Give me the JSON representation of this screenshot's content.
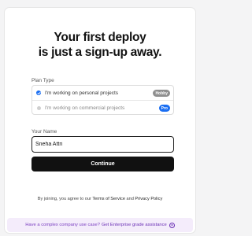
{
  "heading": {
    "line1": "Your first deploy",
    "line2": "is just a sign-up away."
  },
  "plan": {
    "label": "Plan Type",
    "options": [
      {
        "text": "I'm working on personal projects",
        "badge": "Hobby",
        "selected": true
      },
      {
        "text": "I'm working on commercial projects",
        "badge": "Pro",
        "selected": false
      }
    ]
  },
  "name": {
    "label": "Your Name",
    "value": "Sneha Attri"
  },
  "continue_label": "Continue",
  "terms": {
    "prefix": "By joining, you agree to our ",
    "tos": "Terms of Service",
    "and": " and ",
    "privacy": "Privacy Policy"
  },
  "footer": {
    "question": "Have a complex company use case?",
    "link": "Get Enterprise grade assistance",
    "icon": "arrow-right-circle-icon"
  },
  "colors": {
    "accent": "#1a6ef2",
    "button": "#111111",
    "footer_bg": "#f4ecfb",
    "footer_text": "#6a2fb5"
  }
}
